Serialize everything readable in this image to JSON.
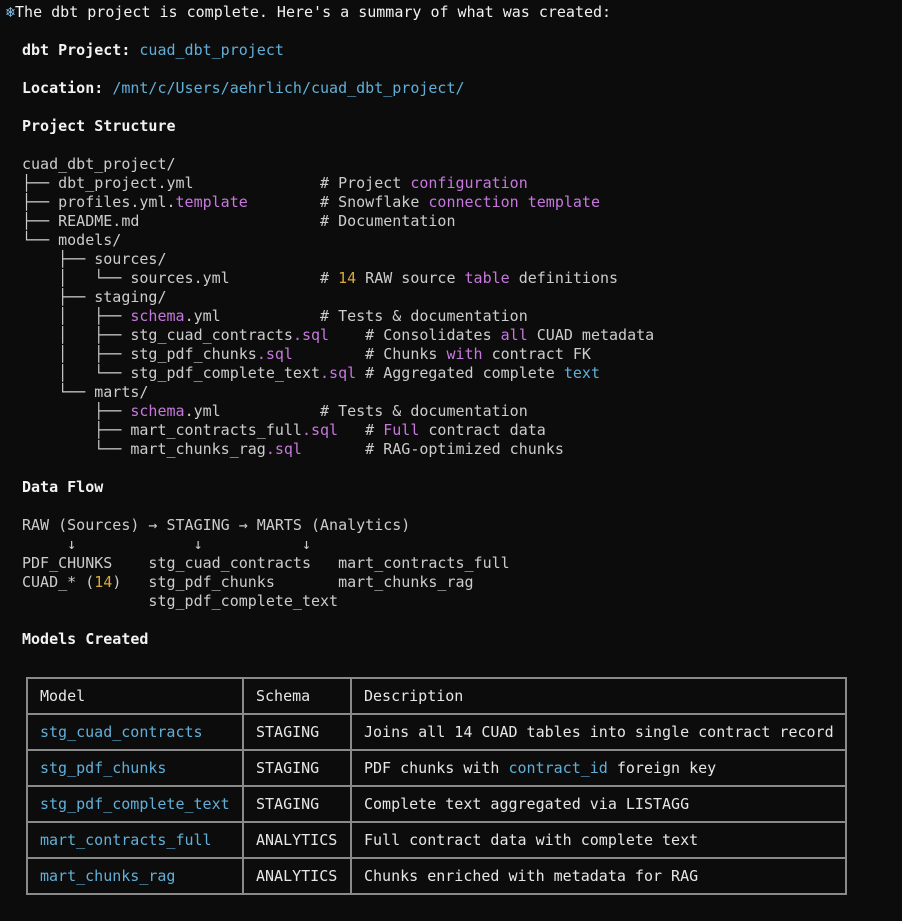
{
  "intro": {
    "icon": "snowflake-icon",
    "text": "The dbt project is complete. Here's a summary of what was created:"
  },
  "project": {
    "label": "dbt Project:",
    "value": "cuad_dbt_project"
  },
  "location": {
    "label": "Location:",
    "value": "/mnt/c/Users/aehrlich/cuad_dbt_project/"
  },
  "structure": {
    "heading": "Project Structure",
    "lines": [
      [
        {
          "t": "cuad_dbt_project/"
        }
      ],
      [
        {
          "t": "├── dbt_project.yml              # Project "
        },
        {
          "t": "configuration",
          "c": "purple"
        }
      ],
      [
        {
          "t": "├── profiles.yml."
        },
        {
          "t": "template",
          "c": "purple"
        },
        {
          "t": "        # Snowflake "
        },
        {
          "t": "connection",
          "c": "purple"
        },
        {
          "t": " "
        },
        {
          "t": "template",
          "c": "purple"
        }
      ],
      [
        {
          "t": "├── README.md                    # Documentation"
        }
      ],
      [
        {
          "t": "└── models/"
        }
      ],
      [
        {
          "t": "    ├── sources/"
        }
      ],
      [
        {
          "t": "    │   └── sources.yml          # "
        },
        {
          "t": "14",
          "c": "yellow"
        },
        {
          "t": " RAW source "
        },
        {
          "t": "table",
          "c": "purple"
        },
        {
          "t": " definitions"
        }
      ],
      [
        {
          "t": "    ├── staging/"
        }
      ],
      [
        {
          "t": "    │   ├── "
        },
        {
          "t": "schema",
          "c": "purple"
        },
        {
          "t": ".yml           # Tests & documentation"
        }
      ],
      [
        {
          "t": "    │   ├── stg_cuad_contracts"
        },
        {
          "t": ".sql",
          "c": "purple"
        },
        {
          "t": "    # Consolidates "
        },
        {
          "t": "all",
          "c": "purple"
        },
        {
          "t": " CUAD metadata"
        }
      ],
      [
        {
          "t": "    │   ├── stg_pdf_chunks"
        },
        {
          "t": ".sql",
          "c": "purple"
        },
        {
          "t": "        # Chunks "
        },
        {
          "t": "with",
          "c": "purple"
        },
        {
          "t": " contract FK"
        }
      ],
      [
        {
          "t": "    │   └── stg_pdf_complete_text"
        },
        {
          "t": ".sql",
          "c": "purple"
        },
        {
          "t": " # Aggregated complete "
        },
        {
          "t": "text",
          "c": "blue"
        }
      ],
      [
        {
          "t": "    └── marts/"
        }
      ],
      [
        {
          "t": "        ├── "
        },
        {
          "t": "schema",
          "c": "purple"
        },
        {
          "t": ".yml           # Tests & documentation"
        }
      ],
      [
        {
          "t": "        ├── mart_contracts_full"
        },
        {
          "t": ".sql",
          "c": "purple"
        },
        {
          "t": "   # "
        },
        {
          "t": "Full",
          "c": "purple"
        },
        {
          "t": " contract data"
        }
      ],
      [
        {
          "t": "        └── mart_chunks_rag"
        },
        {
          "t": ".sql",
          "c": "purple"
        },
        {
          "t": "       # RAG-optimized chunks"
        }
      ]
    ]
  },
  "dataflow": {
    "heading": "Data Flow",
    "lines": [
      [
        {
          "t": "RAW (Sources) → STAGING → MARTS (Analytics)"
        }
      ],
      [
        {
          "t": "     ↓             ↓           ↓"
        }
      ],
      [
        {
          "t": "PDF_CHUNKS    stg_cuad_contracts   mart_contracts_full"
        }
      ],
      [
        {
          "t": "CUAD_* ("
        },
        {
          "t": "14",
          "c": "yellow"
        },
        {
          "t": ")   stg_pdf_chunks       mart_chunks_rag"
        }
      ],
      [
        {
          "t": "              stg_pdf_complete_text"
        }
      ]
    ]
  },
  "models": {
    "heading": "Models Created",
    "headers": [
      "Model",
      "Schema",
      "Description"
    ],
    "rows": [
      {
        "model": "stg_cuad_contracts",
        "schema": "STAGING",
        "desc": [
          {
            "t": "Joins all 14 CUAD tables into single contract record"
          }
        ]
      },
      {
        "model": "stg_pdf_chunks",
        "schema": "STAGING",
        "desc": [
          {
            "t": "PDF chunks with "
          },
          {
            "t": "contract_id",
            "c": "blue"
          },
          {
            "t": " foreign key"
          }
        ]
      },
      {
        "model": "stg_pdf_complete_text",
        "schema": "STAGING",
        "desc": [
          {
            "t": "Complete text aggregated via LISTAGG"
          }
        ]
      },
      {
        "model": "mart_contracts_full",
        "schema": "ANALYTICS",
        "desc": [
          {
            "t": "Full contract data with complete text"
          }
        ]
      },
      {
        "model": "mart_chunks_rag",
        "schema": "ANALYTICS",
        "desc": [
          {
            "t": "Chunks enriched with metadata for RAG"
          }
        ]
      }
    ]
  }
}
